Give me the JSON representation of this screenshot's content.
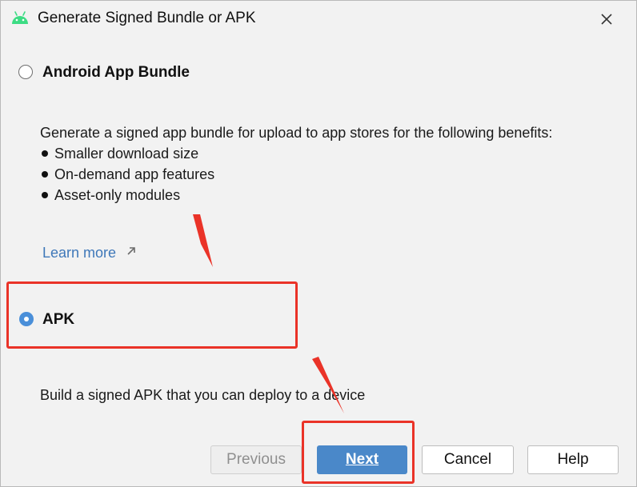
{
  "window": {
    "title": "Generate Signed Bundle or APK",
    "title_icon": "android-icon",
    "close_icon": "close-icon"
  },
  "bundle_option": {
    "label": "Android App Bundle",
    "selected": false,
    "description": "Generate a signed app bundle for upload to app stores for the following benefits:",
    "benefits": [
      "Smaller download size",
      "On-demand app features",
      "Asset-only modules"
    ],
    "learn_more": "Learn more",
    "learn_more_icon": "external-link-arrow-icon"
  },
  "apk_option": {
    "label": "APK",
    "selected": true,
    "description": "Build a signed APK that you can deploy to a device"
  },
  "buttons": {
    "previous": "Previous",
    "next": "Next",
    "cancel": "Cancel",
    "help": "Help"
  },
  "colors": {
    "accent": "#4a88c9",
    "link": "#3f78b9",
    "annotation": "#ea3328",
    "android_green": "#3ddc84"
  }
}
